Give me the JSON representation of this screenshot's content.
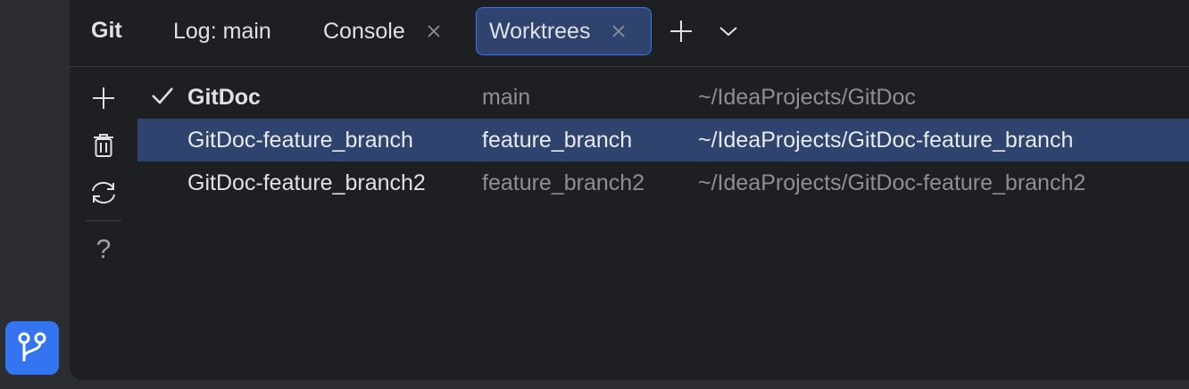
{
  "tool_window": {
    "title": "Git",
    "tabs": [
      {
        "label": "Log: main",
        "closable": false,
        "active": false
      },
      {
        "label": "Console",
        "closable": true,
        "active": false
      },
      {
        "label": "Worktrees",
        "closable": true,
        "active": true
      }
    ],
    "new_tab_icon": "plus-icon",
    "tab_menu_icon": "chevron-down-icon"
  },
  "toolbar": {
    "items": [
      "plus-icon",
      "trash-icon",
      "refresh-icon",
      "help-icon"
    ],
    "help_label": "?"
  },
  "worktrees": [
    {
      "name": "GitDoc",
      "branch": "main",
      "path": "~/IdeaProjects/GitDoc",
      "current": true,
      "selected": false
    },
    {
      "name": "GitDoc-feature_branch",
      "branch": "feature_branch",
      "path": "~/IdeaProjects/GitDoc-feature_branch",
      "current": false,
      "selected": true
    },
    {
      "name": "GitDoc-feature_branch2",
      "branch": "feature_branch2",
      "path": "~/IdeaProjects/GitDoc-feature_branch2",
      "current": false,
      "selected": false
    }
  ],
  "colors": {
    "accent": "#3574f0",
    "selection": "#2e436e",
    "panel_bg": "#1e1f22",
    "frame_bg": "#2b2d30"
  }
}
